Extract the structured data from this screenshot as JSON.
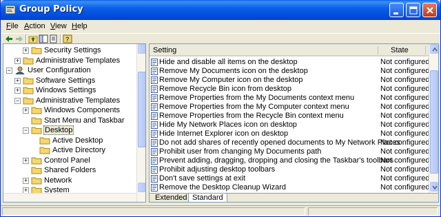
{
  "window": {
    "title": "Group Policy"
  },
  "menu": {
    "items": [
      {
        "label": "File",
        "key": "F",
        "rest": "ile"
      },
      {
        "label": "Action",
        "key": "A",
        "rest": "ction"
      },
      {
        "label": "View",
        "key": "V",
        "rest": "iew"
      },
      {
        "label": "Help",
        "key": "H",
        "rest": "elp"
      }
    ]
  },
  "toolbar": {
    "icons": [
      "back-arrow-icon",
      "forward-arrow-icon",
      "up-folder-icon",
      "show-hide-tree-icon",
      "export-list-icon",
      "help-icon"
    ]
  },
  "tree": {
    "nodes": [
      {
        "label": "Security Settings",
        "expander": "+",
        "level": 2
      },
      {
        "label": "Administrative Templates",
        "expander": "+",
        "level": 1
      },
      {
        "label": "User Configuration",
        "expander": "−",
        "level": 0
      },
      {
        "label": "Software Settings",
        "expander": "+",
        "level": 1
      },
      {
        "label": "Windows Settings",
        "expander": "+",
        "level": 1
      },
      {
        "label": "Administrative Templates",
        "expander": "−",
        "level": 1
      },
      {
        "label": "Windows Components",
        "expander": "+",
        "level": 2
      },
      {
        "label": "Start Menu and Taskbar",
        "expander": "",
        "level": 2
      },
      {
        "label": "Desktop",
        "expander": "−",
        "level": 2,
        "selected": true
      },
      {
        "label": "Active Desktop",
        "expander": "",
        "level": 3
      },
      {
        "label": "Active Directory",
        "expander": "",
        "level": 3
      },
      {
        "label": "Control Panel",
        "expander": "+",
        "level": 2
      },
      {
        "label": "Shared Folders",
        "expander": "",
        "level": 2
      },
      {
        "label": "Network",
        "expander": "+",
        "level": 2
      },
      {
        "label": "System",
        "expander": "+",
        "level": 2
      }
    ]
  },
  "list": {
    "columns": {
      "setting": "Setting",
      "state": "State"
    },
    "rows": [
      {
        "setting": "Hide and disable all items on the desktop",
        "state": "Not configured"
      },
      {
        "setting": "Remove My Documents icon on the desktop",
        "state": "Not configured"
      },
      {
        "setting": "Remove My Computer icon on the desktop",
        "state": "Not configured"
      },
      {
        "setting": "Remove Recycle Bin icon from desktop",
        "state": "Not configured"
      },
      {
        "setting": "Remove Properties from the My Documents context menu",
        "state": "Not configured"
      },
      {
        "setting": "Remove Properties from the My Computer context menu",
        "state": "Not configured"
      },
      {
        "setting": "Remove Properties from the Recycle Bin context menu",
        "state": "Not configured"
      },
      {
        "setting": "Hide My Network Places icon on desktop",
        "state": "Not configured"
      },
      {
        "setting": "Hide Internet Explorer icon on desktop",
        "state": "Not configured"
      },
      {
        "setting": "Do not add shares of recently opened documents to My Network Places",
        "state": "Not configured"
      },
      {
        "setting": "Prohibit user from changing My Documents path",
        "state": "Not configured"
      },
      {
        "setting": "Prevent adding, dragging, dropping and closing the Taskbar's toolbars",
        "state": "Not configured"
      },
      {
        "setting": "Prohibit adjusting desktop toolbars",
        "state": "Not configured"
      },
      {
        "setting": "Don't save settings at exit",
        "state": "Not configured"
      },
      {
        "setting": "Remove the Desktop Cleanup Wizard",
        "state": "Not configured"
      }
    ]
  },
  "tabs": [
    {
      "label": "Extended",
      "active": false
    },
    {
      "label": "Standard",
      "active": true
    }
  ],
  "colors": {
    "titlebar": "#0a5ee5",
    "window_bg": "#ece9d8",
    "folder": "#f5d76e",
    "close_button": "#c0391b"
  }
}
